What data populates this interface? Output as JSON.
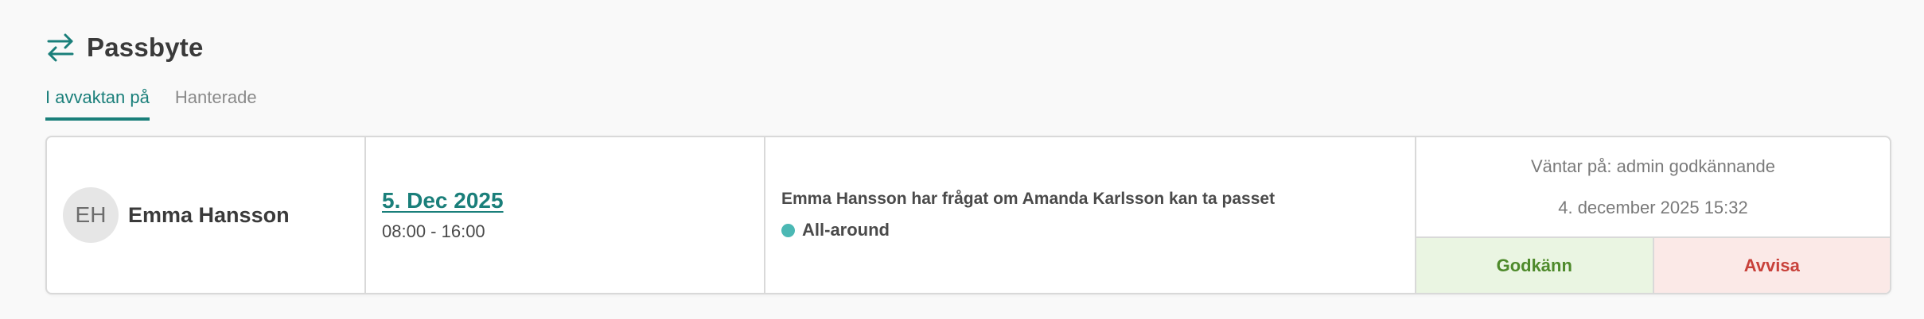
{
  "header": {
    "title": "Passbyte",
    "icon": "swap-arrows-icon",
    "accent_color": "#1a7f7a"
  },
  "tabs": [
    {
      "label": "I avvaktan på",
      "active": true
    },
    {
      "label": "Hanterade",
      "active": false
    }
  ],
  "request": {
    "person": {
      "initials": "EH",
      "name": "Emma Hansson"
    },
    "shift": {
      "date": "5. Dec 2025",
      "time": "08:00 - 16:00"
    },
    "description": "Emma Hansson har frågat om Amanda Karlsson kan ta passet",
    "role": {
      "label": "All-around",
      "color": "#4bb8b4"
    },
    "status": {
      "waiting_text": "Väntar på: admin godkännande",
      "timestamp": "4. december 2025 15:32"
    },
    "actions": {
      "approve_label": "Godkänn",
      "reject_label": "Avvisa"
    }
  }
}
